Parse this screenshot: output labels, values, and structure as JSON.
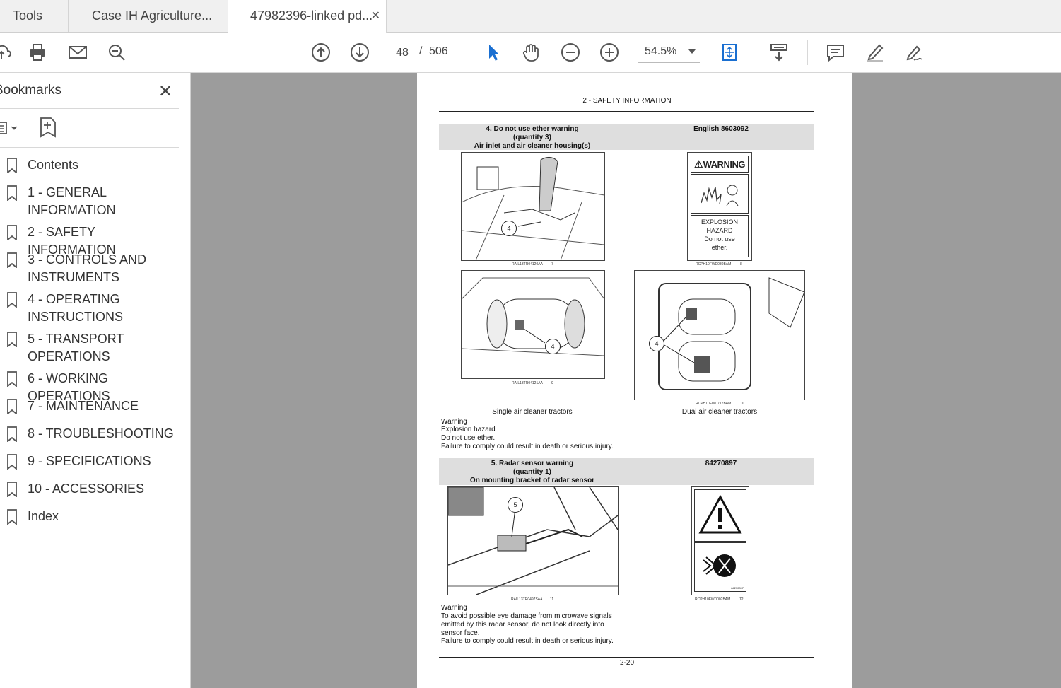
{
  "tabs": [
    {
      "label": "Tools"
    },
    {
      "label": "Case IH Agriculture..."
    },
    {
      "label": "47982396-linked pd...",
      "close": "✕"
    }
  ],
  "toolbar": {
    "page_current": "48",
    "page_separator": "/",
    "page_total": "506",
    "zoom": "54.5%"
  },
  "sidebar": {
    "title": "Bookmarks",
    "close": "✕",
    "items": [
      {
        "label": "Contents"
      },
      {
        "label": "1 - GENERAL INFORMATION"
      },
      {
        "label": "2 - SAFETY INFORMATION"
      },
      {
        "label": "3 - CONTROLS AND INSTRUMENTS"
      },
      {
        "label": "4 - OPERATING INSTRUCTIONS"
      },
      {
        "label": "5 - TRANSPORT OPERATIONS"
      },
      {
        "label": "6 - WORKING OPERATIONS"
      },
      {
        "label": "7 - MAINTENANCE"
      },
      {
        "label": "8 - TROUBLESHOOTING"
      },
      {
        "label": "9 - SPECIFICATIONS"
      },
      {
        "label": "10 - ACCESSORIES"
      },
      {
        "label": "Index"
      }
    ]
  },
  "document": {
    "header": "2 - SAFETY INFORMATION",
    "section4": {
      "title_line1": "4.  Do not use ether warning",
      "title_line2": "(quantity 3)",
      "title_line3": "Air inlet and air cleaner housing(s)",
      "part": "English 8603092",
      "fig7_code": "RAIL13TR04120AA",
      "fig7_num": "7",
      "fig8_code": "RCPH10FWD080BAM",
      "fig8_num": "8",
      "fig9_code": "RAIL13TR04121AA",
      "fig9_num": "9",
      "fig10_code": "RCPH10FWD717BAM",
      "fig10_num": "10",
      "decal_warning": "WARNING",
      "decal_line1": "EXPLOSION",
      "decal_line2": "HAZARD",
      "decal_line3": "Do not use",
      "decal_line4": "ether.",
      "callout": "4",
      "caption_single": "Single air cleaner tractors",
      "caption_dual": "Dual air cleaner tractors",
      "text": [
        "Warning",
        "Explosion hazard",
        "Do not use ether.",
        "Failure to comply could result in death or serious injury."
      ]
    },
    "section5": {
      "title_line1": "5.  Radar sensor warning",
      "title_line2": "(quantity 1)",
      "title_line3": "On mounting bracket of radar sensor",
      "part": "84270897",
      "callout": "5",
      "fig11_code": "RAIL13TR0497SAA",
      "fig11_num": "11",
      "fig12_code": "RCPH10FWD002BAM",
      "fig12_num": "12",
      "decal_code": "84270897",
      "text": [
        "Warning",
        "To avoid possible eye damage from microwave signals",
        "emitted by this radar sensor, do not look directly into",
        "sensor face.",
        "Failure to comply could result in death or serious injury."
      ]
    },
    "footer": "2-20"
  }
}
